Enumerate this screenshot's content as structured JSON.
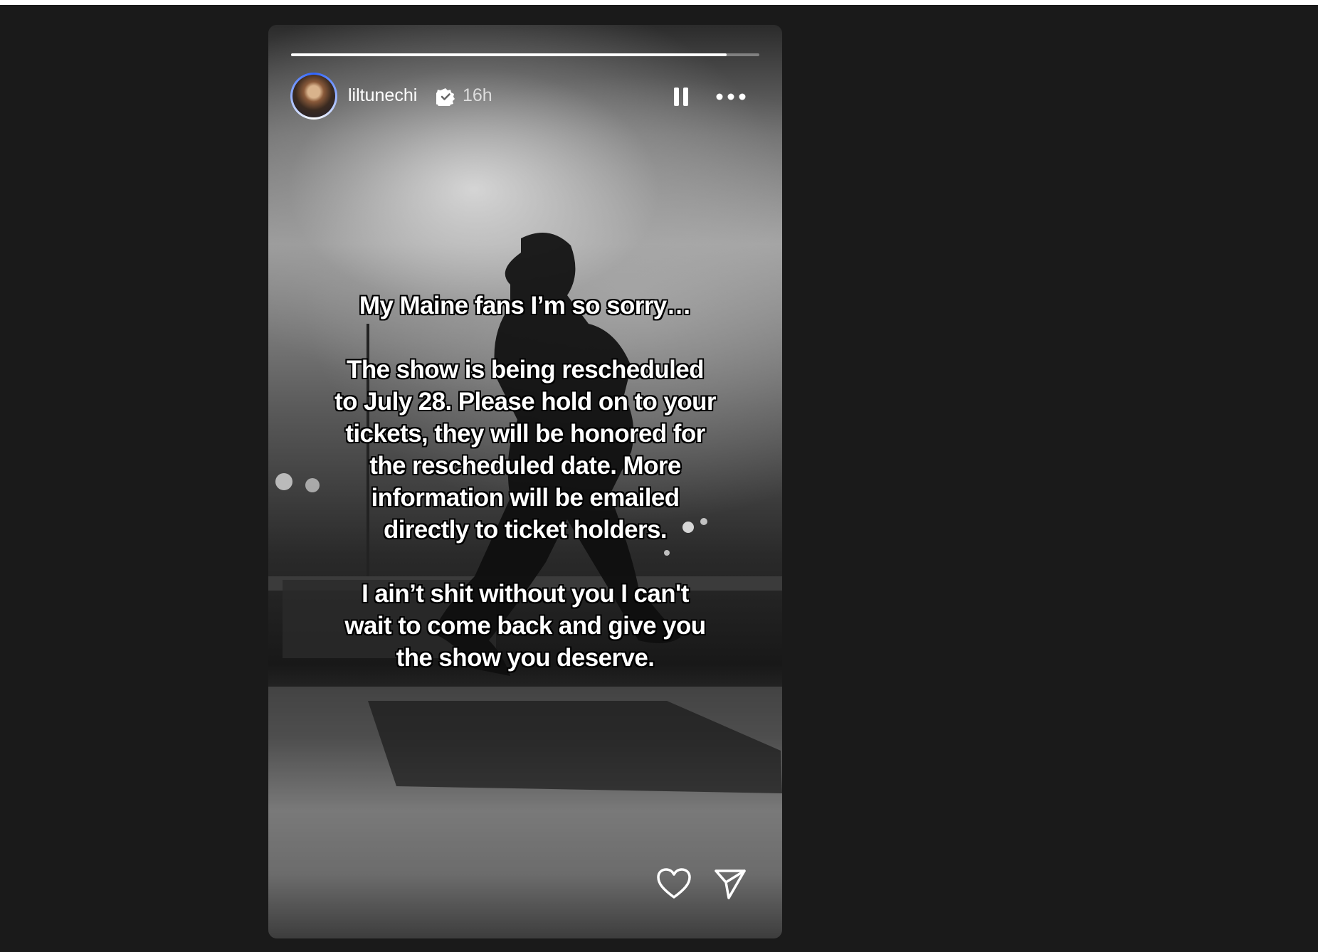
{
  "story": {
    "username": "liltunechi",
    "time": "16h",
    "progress": 0.93,
    "caption_lines": [
      "My Maine fans I’m so sorry…",
      "",
      "The show is being rescheduled",
      "to July 28. Please hold on to your",
      "tickets, they will be honored for",
      "the rescheduled date. More",
      "information will be emailed",
      "directly to ticket holders.",
      "",
      "I ain’t shit without you I can't",
      "wait to come back and give you",
      "the show you deserve."
    ]
  },
  "icons": {
    "verified": "verified-badge-icon",
    "pause": "pause-icon",
    "more": "more-options-icon",
    "like": "heart-icon",
    "share": "send-icon"
  },
  "colors": {
    "page_background": "#1a1a1a",
    "avatar_ring": "#2e64ff",
    "text": "#ffffff"
  }
}
